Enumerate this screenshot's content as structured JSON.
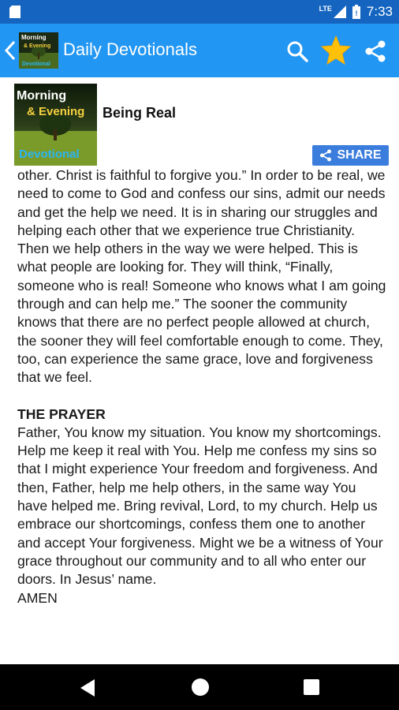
{
  "status_bar": {
    "time": "7:33",
    "network_label": "LTE",
    "icons": [
      "sd-card-icon",
      "signal-icon",
      "battery-icon"
    ]
  },
  "app_bar": {
    "title": "Daily Devotionals",
    "logo_text": [
      "Morning",
      "& Evening",
      "Devotional"
    ],
    "icons": [
      "back-icon",
      "search-icon",
      "star-icon",
      "share-icon"
    ],
    "accent_color": "#2196f3",
    "star_color": "#ffc107"
  },
  "entry": {
    "logo_text": [
      "Morning",
      "& Evening",
      "Devotional"
    ],
    "title": "Being Real",
    "share_label": "SHARE",
    "paragraph": "other. Christ is faithful to forgive you.” In order to be real, we need to come to God and confess our sins, admit our needs and get the help we need. It is in sharing our struggles and helping each other that we experience true Christianity. Then we help others in the way we were helped. This is what people are looking for. They will think, “Finally, someone who is real! Someone who knows what I am going through and can help me.” The sooner the community knows that there are no perfect people allowed at church, the sooner they will feel comfortable enough to come. They, too, can experience the same grace, love and forgiveness that we feel.",
    "prayer_heading": "THE PRAYER",
    "prayer_text": "Father, You know my situation. You know my shortcomings. Help me keep it real with You. Help me confess my sins so that I might experience Your freedom and forgiveness. And then, Father, help me help others, in the same way You have helped me. Bring revival, Lord, to my church. Help us embrace our shortcomings, confess them one to another and accept Your forgiveness. Might we be a witness of Your grace throughout our community and to all who enter our doors. In Jesus’ name.",
    "amen": "AMEN"
  },
  "nav_bar": {
    "icons": [
      "nav-back-icon",
      "nav-home-icon",
      "nav-recents-icon"
    ]
  }
}
